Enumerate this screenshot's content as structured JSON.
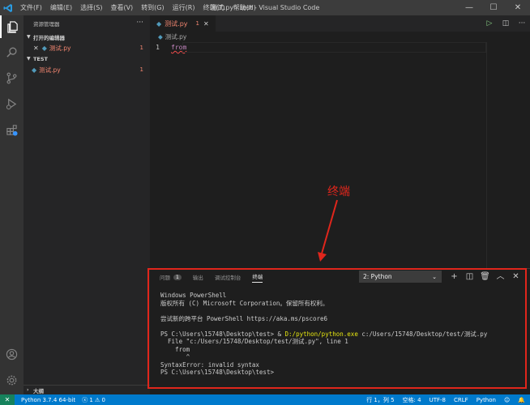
{
  "window": {
    "title": "测试.py - test - Visual Studio Code",
    "menu": [
      "文件(F)",
      "编辑(E)",
      "选择(S)",
      "查看(V)",
      "转到(G)",
      "运行(R)",
      "终端(T)",
      "帮助(H)"
    ],
    "controls": {
      "minimize": "—",
      "maximize": "☐",
      "close": "✕"
    }
  },
  "activity_bar": {
    "icons": [
      "files-icon",
      "search-icon",
      "source-control-icon",
      "run-debug-icon",
      "extensions-icon",
      "account-icon",
      "settings-gear-icon"
    ]
  },
  "sidebar": {
    "title": "资源管理器",
    "more": "···",
    "open_editors": {
      "label": "打开的编辑器",
      "items": [
        {
          "close": "✕",
          "name": "测试.py",
          "count": "1"
        }
      ]
    },
    "workspace": {
      "label": "TEST",
      "items": [
        {
          "name": "测试.py",
          "count": "1"
        }
      ]
    },
    "outline": "大纲"
  },
  "editor": {
    "tab": {
      "name": "测试.py",
      "count": "1",
      "close": "✕"
    },
    "breadcrumb": "测试.py",
    "lines": [
      {
        "number": "1",
        "code": "from"
      }
    ]
  },
  "annotation": {
    "label": "终端"
  },
  "panel": {
    "tabs": [
      {
        "label": "问题",
        "badge": "1"
      },
      {
        "label": "输出"
      },
      {
        "label": "调试控制台"
      },
      {
        "label": "终端"
      }
    ],
    "terminal_select": "2: Python",
    "actions": {
      "add": "+",
      "split": "◫",
      "trash": "🗑",
      "maximize": "︿",
      "close": "✕"
    },
    "terminal": {
      "line1": "Windows PowerShell",
      "line2": "版权所有 (C) Microsoft Corporation。保留所有权利。",
      "line3": "",
      "line4": "尝试新的跨平台 PowerShell https://aka.ms/pscore6",
      "line5": "",
      "line6_prompt": "PS C:\\Users\\15748\\Desktop\\test> & ",
      "line6_exe": "D:/python/python.exe",
      "line6_rest": " c:/Users/15748/Desktop/test/测试.py",
      "line7": "  File \"c:/Users/15748/Desktop/test/测试.py\", line 1",
      "line8": "    from",
      "line9": "       ^",
      "line10": "SyntaxError: invalid syntax",
      "line11": "PS C:\\Users\\15748\\Desktop\\test>"
    }
  },
  "statusbar": {
    "remote": "✕",
    "interpreter": "Python 3.7.4 64-bit",
    "problems": "ⓧ 1 ⚠ 0",
    "position": "行 1，列 5",
    "spaces": "空格: 4",
    "encoding": "UTF-8",
    "eol": "CRLF",
    "language": "Python",
    "feedback": "☺",
    "bell": "🔔"
  }
}
